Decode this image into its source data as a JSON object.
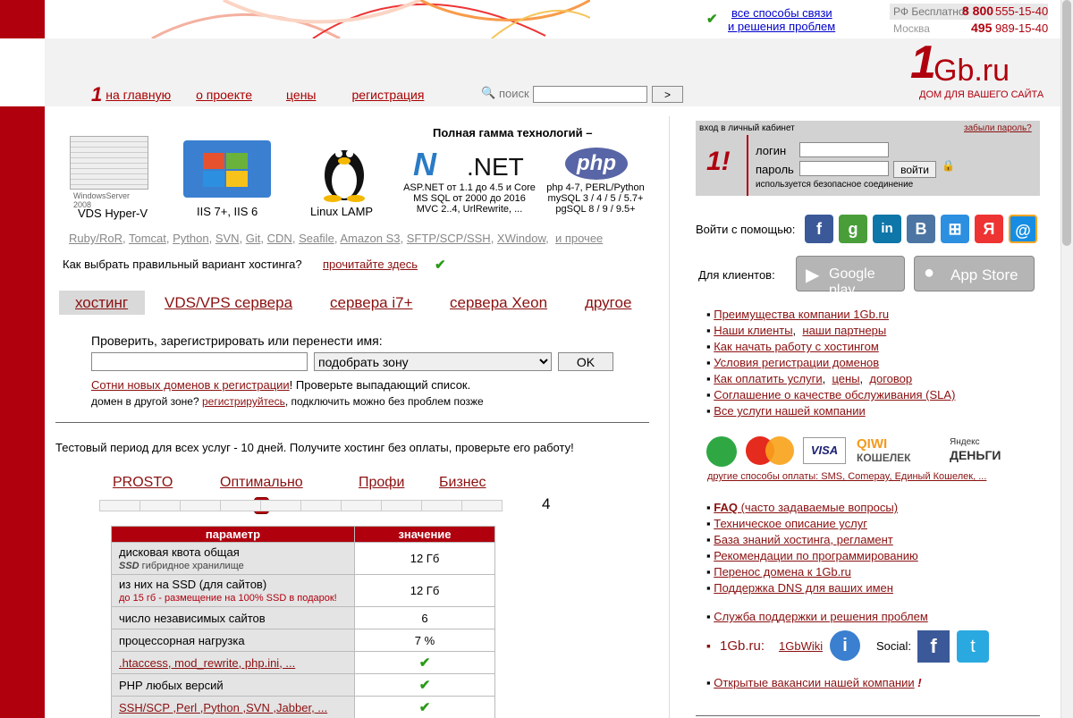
{
  "header": {
    "contact_line1": "все способы связи",
    "contact_line2": "и решения проблем",
    "phone_label": "РФ Бесплатно!",
    "phone_code": "8 800",
    "phone_num": "555-15-40",
    "city": "Москва",
    "city_code": "495",
    "city_num": "989-15-40",
    "logo": "1Gb.ru",
    "logo_slogan": "ДОМ ДЛЯ ВАШЕГО САЙТА",
    "search_label": "поиск",
    "search_btn": ">"
  },
  "nav": [
    "на главную",
    "о проекте",
    "цены",
    "регистрация"
  ],
  "tech": {
    "heading": "Полная гамма технологий –",
    "windows_logo": "WindowsServer 2008",
    "windows_caption": "VDS Hyper-V",
    "iis_caption": "IIS 7+, IIS 6",
    "linux_caption": "Linux LAMP",
    "net_logo": ".NET",
    "net_line1": "ASP.NET от 1.1 до 4.5 и Core",
    "net_line2": "MS SQL от 2000 до 2016",
    "net_line3": "MVC 2..4, UrlRewrite, ...",
    "php_logo": "php",
    "php_line1": "php 4-7, PERL/Python",
    "php_line2": "mySQL 3 / 4 / 5 / 5.7+",
    "php_line3": "pgSQL 8 / 9 / 9.5+",
    "links": [
      "Ruby/RoR",
      "Tomcat",
      "Python",
      "SVN",
      "Git",
      "CDN",
      "Seafile",
      "Amazon S3",
      "SFTP/SCP/SSH",
      "XWindow"
    ],
    "more": "и прочее"
  },
  "choose": {
    "text": "Как выбрать правильный вариант хостинга?",
    "link": "прочитайте здесь"
  },
  "tabs": [
    "хостинг",
    "VDS/VPS сервера",
    "сервера i7+",
    "сервера Xeon",
    "другое"
  ],
  "domain": {
    "label": "Проверить, зарегистрировать или перенести имя:",
    "select": "подобрать зону",
    "ok": "OK",
    "link1": "Сотни новых доменов к регистрации",
    "text1": "! Проверьте выпадающий список.",
    "text2a": "домен в другой зоне?",
    "link2": "регистрируйтесь",
    "text2b": ", подключить можно без проблем позже"
  },
  "trial": "Тестовый период для всех услуг - 10 дней. Получите хостинг без оплаты, проверьте его работу!",
  "plans": [
    "PROSTO",
    "Оптимально",
    "Профи",
    "Бизнес"
  ],
  "slider_value": "4",
  "table": {
    "h_param": "параметр",
    "h_value": "значение",
    "rows": [
      {
        "p": "дисковая квота общая",
        "sub": "SSD гибридное хранилище",
        "v": "12 Гб"
      },
      {
        "p": "из них на SSD (для сайтов)",
        "sub": "до 15 гб - размещение на 100% SSD в подарок!",
        "v": "12 Гб"
      },
      {
        "p": "число независимых сайтов",
        "sub": "",
        "v": "6"
      },
      {
        "p": "процессорная нагрузка",
        "sub": "",
        "v": "7 %"
      },
      {
        "p": ".htaccess, mod_rewrite, php.ini, ...",
        "sub": "",
        "v": "✔"
      },
      {
        "p": "PHP любых версий",
        "sub": "",
        "v": "✔"
      },
      {
        "p": "SSH/SCP ,Perl ,Python ,SVN ,Jabber, ...",
        "sub": "",
        "v": "✔"
      }
    ]
  },
  "login": {
    "title": "вход в личный кабинет",
    "forgot": "забыли пароль?",
    "login_label": "логин",
    "pass_label": "пароль",
    "btn": "войти",
    "secure": "используется безопасное соединение"
  },
  "social_login": "Войти с помощью:",
  "clients": "Для клиентов:",
  "gplay": "Google play",
  "appstore": "App Store",
  "right_links": [
    "Преимущества компании 1Gb.ru",
    "Наши клиенты",
    "наши партнеры",
    "Как начать работу с хостингом",
    "Условия регистрации доменов",
    "Как оплатить услуги",
    "цены",
    "договор",
    "Соглашение о качестве обслуживания (SLA)",
    "Все услуги нашей компании"
  ],
  "pay_other": "другие способы оплаты: SMS, Comepay, Единый Кошелек, ...",
  "right_links2": [
    "FAQ",
    "(часто задаваемые вопросы)",
    "Техническое описание услуг",
    "База знаний хостинга, регламент",
    "Рекомендации по программированию",
    "Перенос домена к 1Gb.ru",
    "Поддержка DNS для ваших имен"
  ],
  "support": "Служба поддержки и решения проблем",
  "site": "1Gb.ru:",
  "wiki": "1GbWiki",
  "social": "Social:",
  "jobs": "Открытые вакансии нашей компании"
}
